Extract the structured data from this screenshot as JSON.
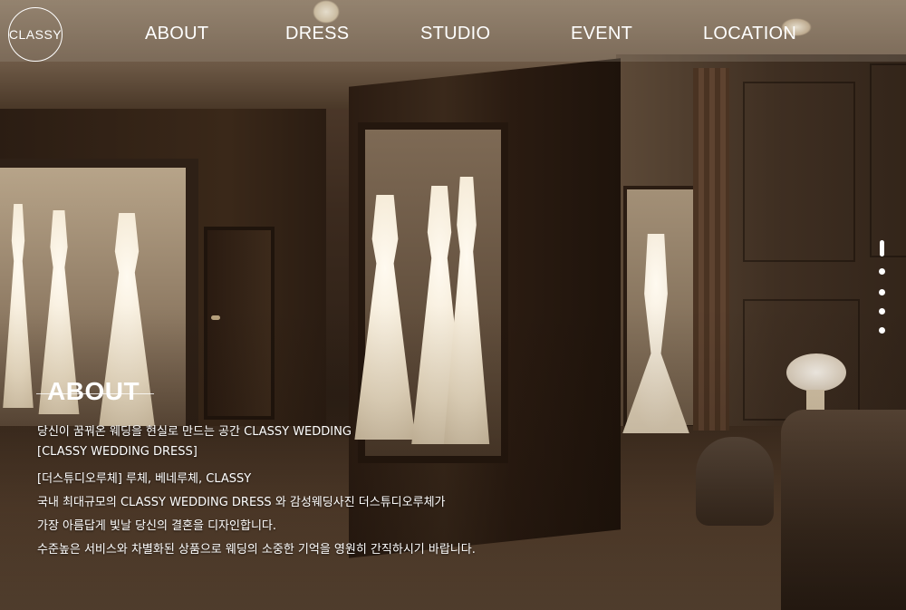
{
  "header": {
    "logo_text": "CLASSY",
    "nav": [
      {
        "label": "ABOUT"
      },
      {
        "label": "DRESS"
      },
      {
        "label": "STUDIO"
      },
      {
        "label": "EVENT"
      },
      {
        "label": "LOCATION"
      }
    ]
  },
  "slider": {
    "count": 5,
    "active_index": 0
  },
  "about": {
    "title": "ABOUT",
    "lines": [
      "당신이 꿈꿔온 웨딩을 현실로 만드는 공간 CLASSY WEDDING",
      "[CLASSY WEDDING DRESS]",
      "[더스튜디오루체] 루체, 베네루체, CLASSY",
      "국내 최대규모의 CLASSY WEDDING DRESS 와 감성웨딩사진 더스튜디오루체가",
      "가장 아름답게 빛날 당신의 결혼을 디자인합니다.",
      "수준높은 서비스와 차별화된 상품으로 웨딩의 소중한 기억을 영원히 간직하시기 바랍니다."
    ]
  },
  "colors": {
    "header_overlay": "#a0968a",
    "text": "#ffffff",
    "background": "#2a1d14"
  }
}
